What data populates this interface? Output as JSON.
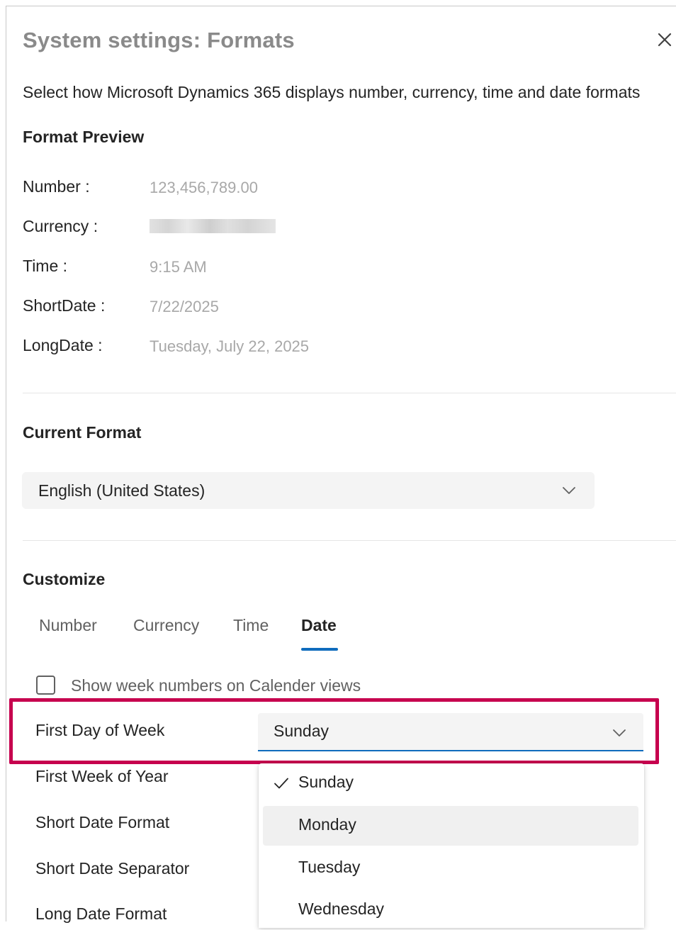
{
  "dialog": {
    "title": "System settings: Formats",
    "subtitle": "Select how Microsoft Dynamics 365 displays number, currency, time and date formats"
  },
  "preview": {
    "heading": "Format Preview",
    "rows": [
      {
        "label": "Number :",
        "value": "123,456,789.00"
      },
      {
        "label": "Currency :",
        "value": ""
      },
      {
        "label": "Time :",
        "value": "9:15 AM"
      },
      {
        "label": "ShortDate :",
        "value": "7/22/2025"
      },
      {
        "label": "LongDate :",
        "value": "Tuesday, July 22, 2025"
      }
    ]
  },
  "current_format": {
    "heading": "Current Format",
    "value": "English (United States)"
  },
  "customize": {
    "heading": "Customize",
    "tabs": [
      {
        "label": "Number",
        "active": false
      },
      {
        "label": "Currency",
        "active": false
      },
      {
        "label": "Time",
        "active": false
      },
      {
        "label": "Date",
        "active": true
      }
    ],
    "week_numbers_label": "Show week numbers on Calender views",
    "week_numbers_checked": false,
    "fields": [
      {
        "label": "First Day of Week"
      },
      {
        "label": "First Week of Year"
      },
      {
        "label": "Short Date Format"
      },
      {
        "label": "Short Date Separator"
      },
      {
        "label": "Long Date Format"
      }
    ],
    "first_day_value": "Sunday",
    "first_day_options": [
      {
        "label": "Sunday",
        "selected": true
      },
      {
        "label": "Monday",
        "selected": false,
        "hovered": true
      },
      {
        "label": "Tuesday",
        "selected": false
      },
      {
        "label": "Wednesday",
        "selected": false
      }
    ]
  },
  "colors": {
    "accent": "#0f6cbd",
    "highlight_border": "#c6004e",
    "muted_text": "#a8a8a8"
  }
}
